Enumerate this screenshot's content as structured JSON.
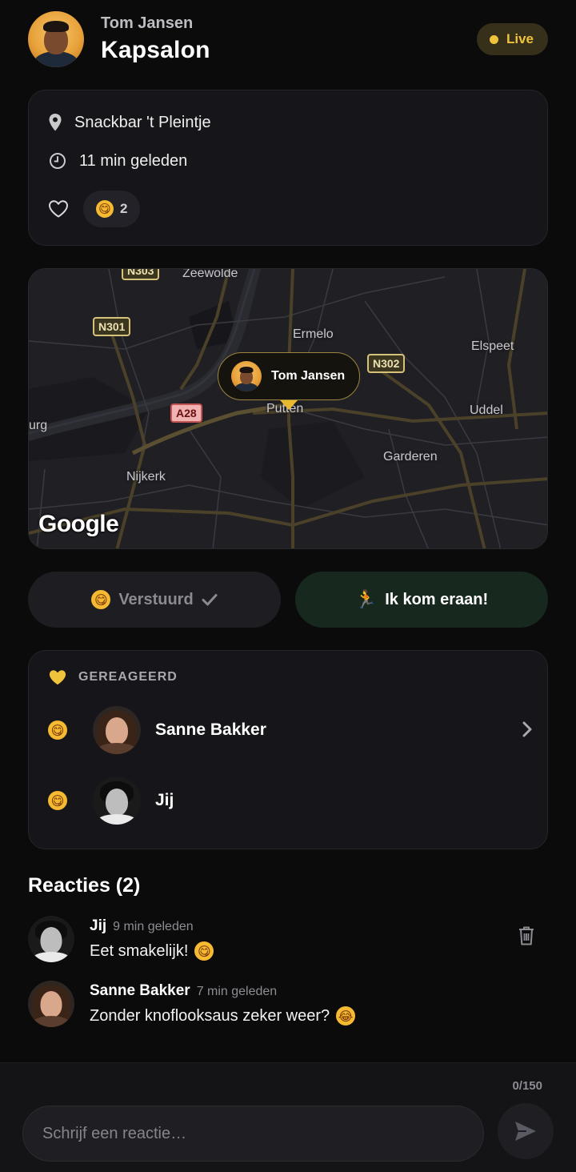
{
  "header": {
    "user_name": "Tom Jansen",
    "title": "Kapsalon",
    "live_label": "Live"
  },
  "info": {
    "location": "Snackbar 't Pleintje",
    "time_ago": "11 min geleden",
    "reaction_emoji": "😋",
    "reaction_count": "2"
  },
  "map": {
    "labels": [
      "Zeewolde",
      "Ermelo",
      "Elspeet",
      "Putten",
      "Uddel",
      "Garderen",
      "Nijkerk",
      "urg"
    ],
    "shields": [
      "N301",
      "N302",
      "A28",
      "N303"
    ],
    "pin_name": "Tom Jansen",
    "logo": "Google"
  },
  "actions": {
    "sent_label": "Verstuurd",
    "sent_emoji": "😋",
    "coming_label": "Ik kom eraan!",
    "coming_icon": "🏃"
  },
  "reacted": {
    "heading": "GEREAGEERD",
    "people": [
      {
        "emoji": "😋",
        "name": "Sanne Bakker"
      },
      {
        "emoji": "😋",
        "name": "Jij"
      }
    ]
  },
  "comments": {
    "title": "Reacties (2)",
    "items": [
      {
        "name": "Jij",
        "time": "9 min geleden",
        "text": "Eet smakelijk!",
        "emoji": "😋"
      },
      {
        "name": "Sanne Bakker",
        "time": "7 min geleden",
        "text": "Zonder knoflooksaus zeker weer?",
        "emoji": "😂"
      }
    ]
  },
  "composer": {
    "counter": "0/150",
    "placeholder": "Schrijf een reactie…"
  },
  "colors": {
    "accent_gold": "#f0c33c",
    "background": "#0b0b0c",
    "card": "#16161a",
    "coming_button": "#17291f"
  }
}
